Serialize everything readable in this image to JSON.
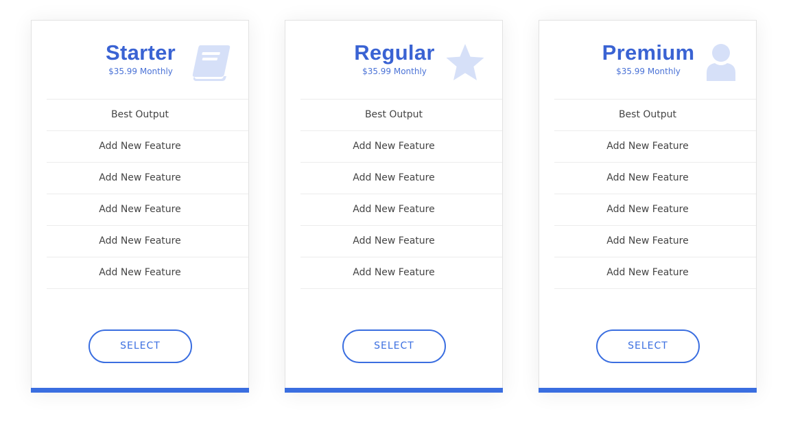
{
  "colors": {
    "accent": "#3a6ee0",
    "title": "#3a63d3",
    "icon": "#d6e0f8",
    "feature_text": "#444444",
    "divider": "#ececec"
  },
  "plans": [
    {
      "title": "Starter",
      "price": "$35.99 Monthly",
      "icon": "book-icon",
      "features": [
        "Best Output",
        "Add New Feature",
        "Add New Feature",
        "Add New Feature",
        "Add New Feature",
        "Add New Feature"
      ],
      "button_label": "SELECT"
    },
    {
      "title": "Regular",
      "price": "$35.99 Monthly",
      "icon": "star-icon",
      "features": [
        "Best Output",
        "Add New Feature",
        "Add New Feature",
        "Add New Feature",
        "Add New Feature",
        "Add New Feature"
      ],
      "button_label": "SELECT"
    },
    {
      "title": "Premium",
      "price": "$35.99 Monthly",
      "icon": "user-icon",
      "features": [
        "Best Output",
        "Add New Feature",
        "Add New Feature",
        "Add New Feature",
        "Add New Feature",
        "Add New Feature"
      ],
      "button_label": "SELECT"
    }
  ]
}
